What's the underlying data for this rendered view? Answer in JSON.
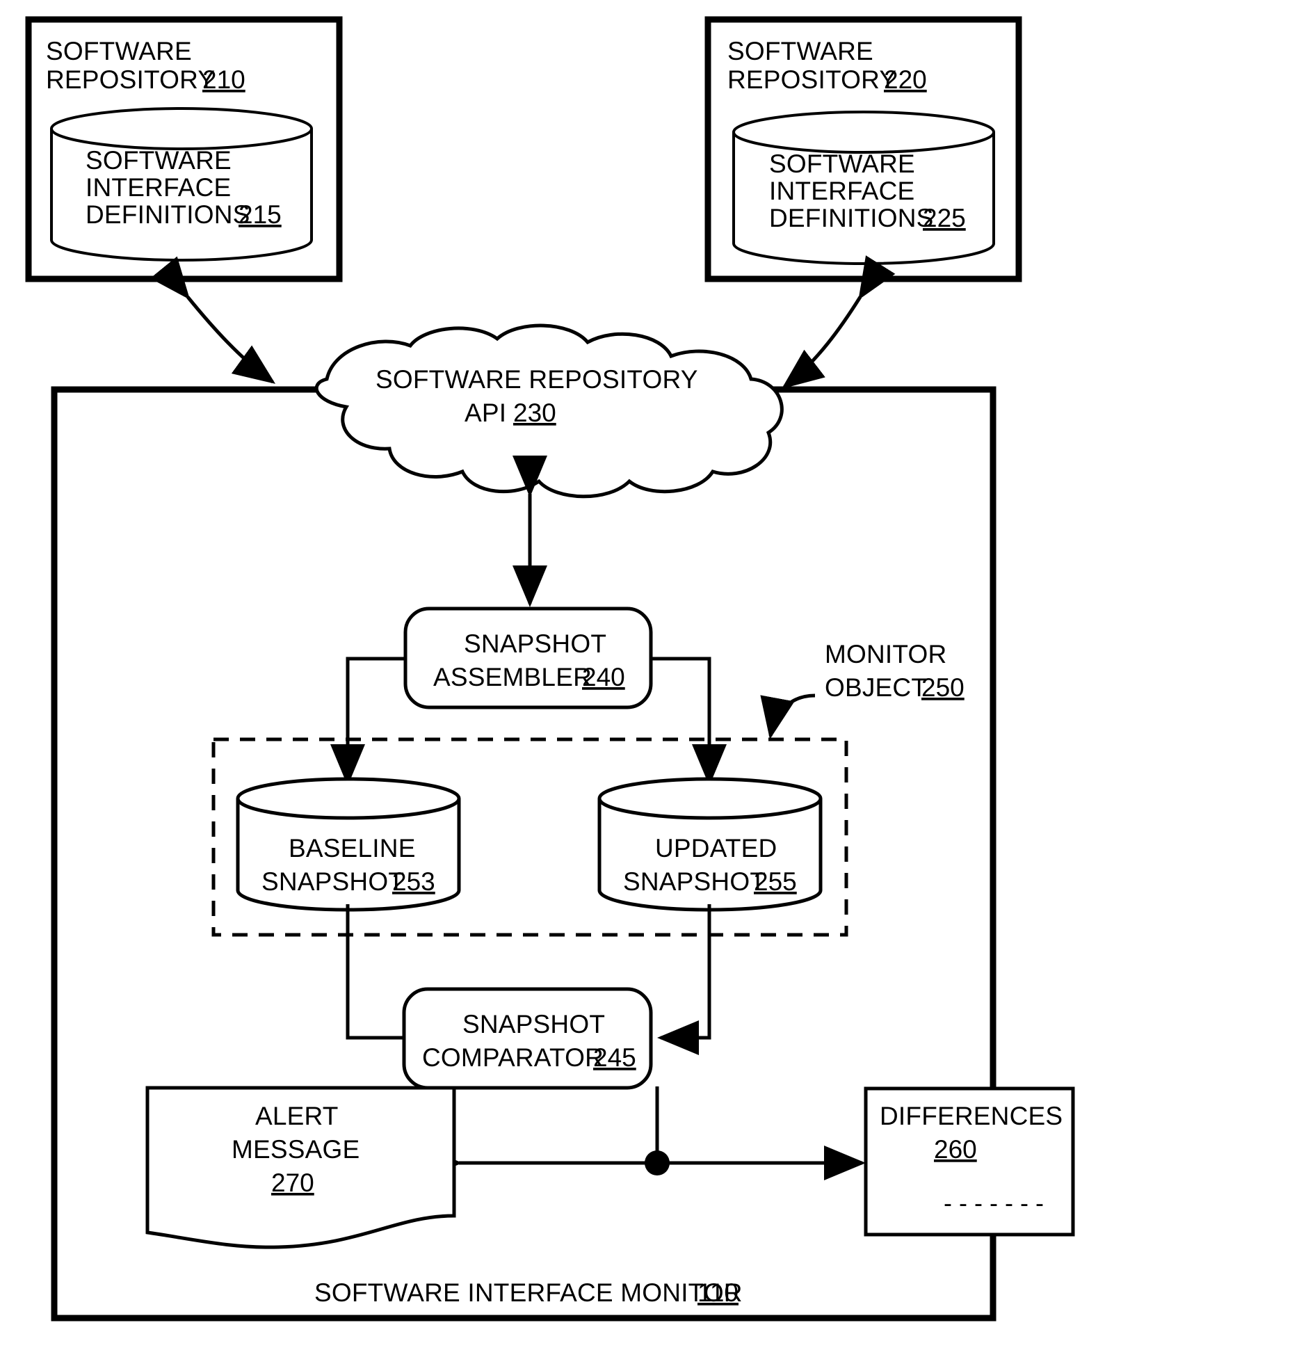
{
  "figure": {
    "type": "patent-block-diagram",
    "background": "#ffffff",
    "line_color": "#000000"
  },
  "repo_left": {
    "title_line1": "SOFTWARE",
    "title_line2": "REPOSITORY",
    "title_ref": "210",
    "db_line1": "SOFTWARE",
    "db_line2": "INTERFACE",
    "db_line3": "DEFINITIONS",
    "db_ref": "215"
  },
  "repo_right": {
    "title_line1": "SOFTWARE",
    "title_line2": "REPOSITORY",
    "title_ref": "220",
    "db_line1": "SOFTWARE",
    "db_line2": "INTERFACE",
    "db_line3": "DEFINITIONS",
    "db_ref": "225"
  },
  "cloud": {
    "line1": "SOFTWARE REPOSITORY",
    "line2": "API",
    "ref": "230"
  },
  "assembler": {
    "line1": "SNAPSHOT",
    "line2": "ASSEMBLER",
    "ref": "240"
  },
  "monitor_object": {
    "line1": "MONITOR",
    "line2": "OBJECT",
    "ref": "250"
  },
  "baseline_snapshot": {
    "line1": "BASELINE",
    "line2": "SNAPSHOT",
    "ref": "253"
  },
  "updated_snapshot": {
    "line1": "UPDATED",
    "line2": "SNAPSHOT",
    "ref": "255"
  },
  "comparator": {
    "line1": "SNAPSHOT",
    "line2": "COMPARATOR",
    "ref": "245"
  },
  "alert_message": {
    "line1": "ALERT",
    "line2": "MESSAGE",
    "ref": "270"
  },
  "differences": {
    "line1": "DIFFERENCES",
    "ref": "260",
    "placeholder": "- - - - - - -"
  },
  "monitor": {
    "title": "SOFTWARE INTERFACE MONITOR",
    "ref": "110"
  }
}
